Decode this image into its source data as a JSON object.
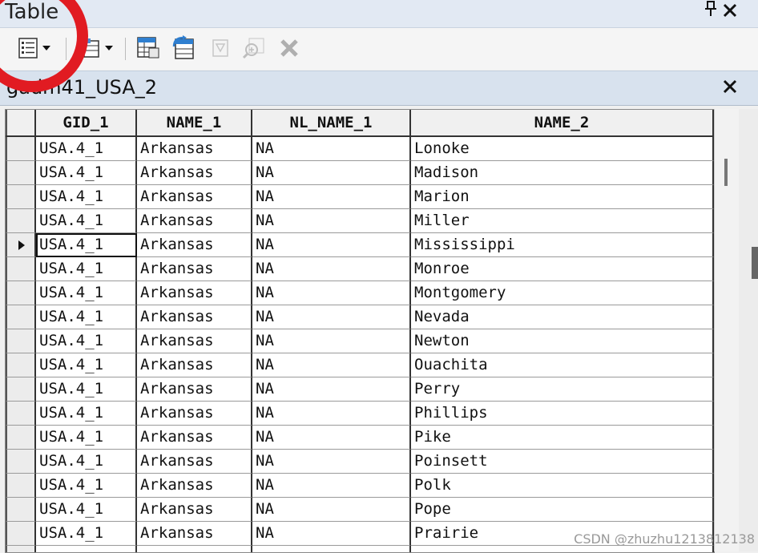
{
  "window": {
    "title": "Table",
    "pin_icon": "pin-icon",
    "close_icon": "close-icon"
  },
  "toolbar": {
    "buttons": [
      {
        "name": "table-options-button",
        "icon": "table-options-icon",
        "has_dropdown": true
      },
      {
        "name": "related-tables-button",
        "icon": "related-tables-icon",
        "has_dropdown": true
      },
      {
        "name": "select-by-attributes-button",
        "icon": "select-by-attributes-icon"
      },
      {
        "name": "switch-selection-button",
        "icon": "switch-selection-icon"
      },
      {
        "name": "clear-selection-button",
        "icon": "clear-selection-icon",
        "disabled": true
      },
      {
        "name": "zoom-to-selected-button",
        "icon": "zoom-to-selected-icon",
        "disabled": true
      },
      {
        "name": "delete-selected-button",
        "icon": "delete-icon",
        "disabled": true
      }
    ]
  },
  "tab": {
    "label": "gadm41_USA_2",
    "close_icon": "close-icon"
  },
  "table": {
    "columns": [
      "GID_1",
      "NAME_1",
      "NL_NAME_1",
      "NAME_2"
    ],
    "current_row_index": 4,
    "rows": [
      [
        "USA.4_1",
        "Arkansas",
        "NA",
        "Lonoke"
      ],
      [
        "USA.4_1",
        "Arkansas",
        "NA",
        "Madison"
      ],
      [
        "USA.4_1",
        "Arkansas",
        "NA",
        "Marion"
      ],
      [
        "USA.4_1",
        "Arkansas",
        "NA",
        "Miller"
      ],
      [
        "USA.4_1",
        "Arkansas",
        "NA",
        "Mississippi"
      ],
      [
        "USA.4_1",
        "Arkansas",
        "NA",
        "Monroe"
      ],
      [
        "USA.4_1",
        "Arkansas",
        "NA",
        "Montgomery"
      ],
      [
        "USA.4_1",
        "Arkansas",
        "NA",
        "Nevada"
      ],
      [
        "USA.4_1",
        "Arkansas",
        "NA",
        "Newton"
      ],
      [
        "USA.4_1",
        "Arkansas",
        "NA",
        "Ouachita"
      ],
      [
        "USA.4_1",
        "Arkansas",
        "NA",
        "Perry"
      ],
      [
        "USA.4_1",
        "Arkansas",
        "NA",
        "Phillips"
      ],
      [
        "USA.4_1",
        "Arkansas",
        "NA",
        "Pike"
      ],
      [
        "USA.4_1",
        "Arkansas",
        "NA",
        "Poinsett"
      ],
      [
        "USA.4_1",
        "Arkansas",
        "NA",
        "Polk"
      ],
      [
        "USA.4_1",
        "Arkansas",
        "NA",
        "Pope"
      ],
      [
        "USA.4_1",
        "Arkansas",
        "NA",
        "Prairie"
      ],
      [
        "",
        "",
        "",
        ""
      ]
    ]
  },
  "watermark": "CSDN @zhuzhu1213812138",
  "colors": {
    "highlight_circle": "#e11b22",
    "title_bar": "#e2e9f3",
    "tab_bar": "#d8e2ee"
  }
}
